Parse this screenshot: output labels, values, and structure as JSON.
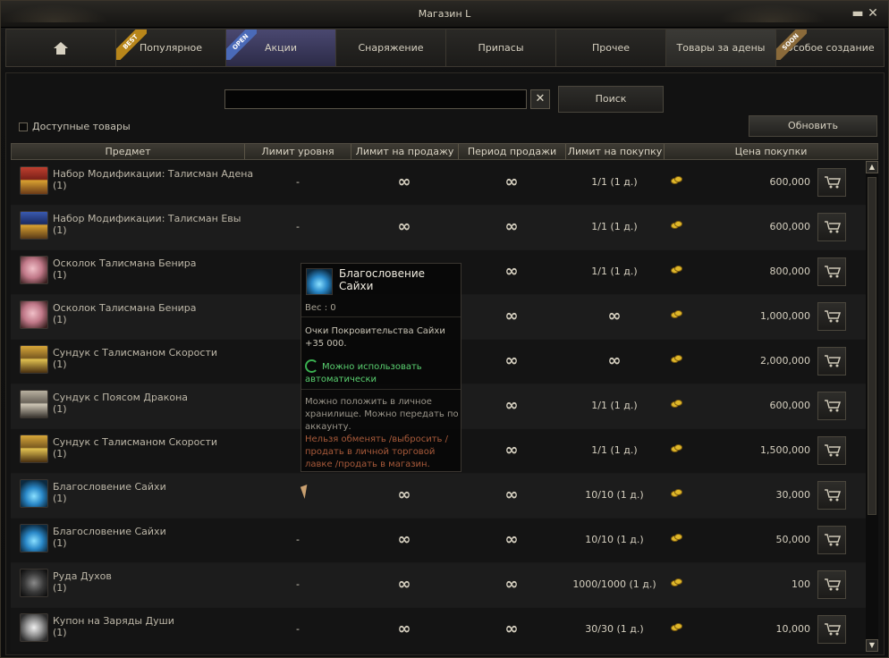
{
  "window": {
    "title": "Магазин L",
    "minimize": "▬",
    "close": "✕"
  },
  "tabs": [
    {
      "label": "",
      "icon": "home-icon",
      "ribbon": ""
    },
    {
      "label": "Популярное",
      "ribbon": "BEST"
    },
    {
      "label": "Акции",
      "ribbon": "OPEN",
      "active": true
    },
    {
      "label": "Снаряжение",
      "ribbon": ""
    },
    {
      "label": "Припасы",
      "ribbon": ""
    },
    {
      "label": "Прочее",
      "ribbon": ""
    },
    {
      "label": "Товары за адены",
      "ribbon": "",
      "selected": true
    },
    {
      "label": "Особое создание",
      "ribbon": "SOON"
    }
  ],
  "search": {
    "value": "",
    "placeholder": "",
    "clear": "✕",
    "button": "Поиск"
  },
  "filter": {
    "available_label": "Доступные товары",
    "available_checked": false
  },
  "refresh_label": "Обновить",
  "columns": [
    "Предмет",
    "Лимит уровня",
    "Лимит на продажу",
    "Период продажи",
    "Лимит на покупку",
    "Цена покупки"
  ],
  "rows": [
    {
      "name": "Набор Модификации: Талисман Адена",
      "qty": "(1)",
      "icon": "chest-red-icon",
      "level": "-",
      "sell": "∞",
      "period": "∞",
      "buy": "1/1 (1 д.)",
      "price": "600,000"
    },
    {
      "name": "Набор Модификации: Талисман Евы",
      "qty": "(1)",
      "icon": "chest-blue-icon",
      "level": "-",
      "sell": "∞",
      "period": "∞",
      "buy": "1/1 (1 д.)",
      "price": "600,000"
    },
    {
      "name": "Осколок Талисмана Бенира",
      "qty": "(1)",
      "icon": "pink-shard-icon",
      "level": "",
      "sell": "",
      "period": "∞",
      "buy": "1/1 (1 д.)",
      "price": "800,000"
    },
    {
      "name": "Осколок Талисмана Бенира",
      "qty": "(1)",
      "icon": "pink-shard-icon",
      "level": "",
      "sell": "",
      "period": "∞",
      "buy": "∞",
      "price": "1,000,000"
    },
    {
      "name": "Сундук с Талисманом Скорости",
      "qty": "(1)",
      "icon": "chest-gold-icon",
      "level": "",
      "sell": "",
      "period": "∞",
      "buy": "∞",
      "price": "2,000,000"
    },
    {
      "name": "Сундук с Поясом Дракона",
      "qty": "(1)",
      "icon": "chest-silver-icon",
      "level": "",
      "sell": "",
      "period": "∞",
      "buy": "1/1 (1 д.)",
      "price": "600,000"
    },
    {
      "name": "Сундук с Талисманом Скорости",
      "qty": "(1)",
      "icon": "chest-gold-icon",
      "level": "",
      "sell": "",
      "period": "∞",
      "buy": "1/1 (1 д.)",
      "price": "1,500,000"
    },
    {
      "name": "Благословение Сайхи",
      "qty": "(1)",
      "icon": "potion-blue-icon",
      "level": "",
      "sell": "∞",
      "period": "∞",
      "buy": "10/10 (1 д.)",
      "price": "30,000"
    },
    {
      "name": "Благословение Сайхи",
      "qty": "(1)",
      "icon": "potion-blue-icon",
      "level": "-",
      "sell": "∞",
      "period": "∞",
      "buy": "10/10 (1 д.)",
      "price": "50,000"
    },
    {
      "name": "Руда Духов",
      "qty": "(1)",
      "icon": "ore-icon",
      "level": "-",
      "sell": "∞",
      "period": "∞",
      "buy": "1000/1000 (1 д.)",
      "price": "100"
    },
    {
      "name": "Купон на Заряды Души",
      "qty": "(1)",
      "icon": "coupon-icon",
      "level": "-",
      "sell": "∞",
      "period": "∞",
      "buy": "30/30 (1 д.)",
      "price": "10,000"
    }
  ],
  "tooltip": {
    "title": "Благословение Сайхи",
    "weight": "Вес :   0",
    "desc": "Очки Покровительства Сайхи +35 000.",
    "auto": "Можно использовать автоматически",
    "store": "Можно положить в личное хранилище. Можно передать по аккаунту.",
    "warn": "Нельзя обменять /выбросить /продать в личной торговой лавке /продать в магазин."
  },
  "colors": {
    "accent_tab": "#3a3960",
    "coin": "#e0b82a",
    "auto_text": "#5ad070",
    "warn_text": "#a85a3a"
  }
}
